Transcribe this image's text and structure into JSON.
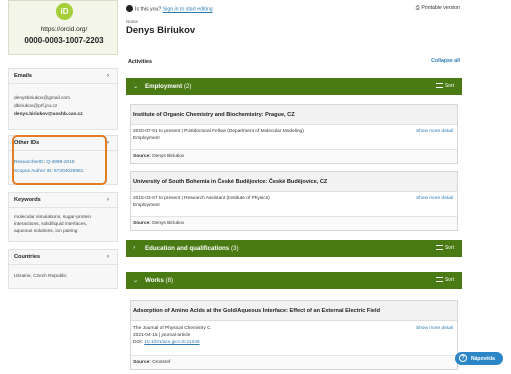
{
  "orcid": {
    "logo": "iD",
    "url": "https://orcid.org/",
    "number": "0000-0003-1007-2203"
  },
  "sidebar": {
    "emails": {
      "title": "Emails",
      "items": [
        "denysbiriukov@gmail.com",
        "dbiriukov@prf.jcu.cz",
        "denys.biriukov@uochb.cas.cz"
      ]
    },
    "other_ids": {
      "title": "Other IDs",
      "items": [
        "ResearcherID: Q-4898-2018",
        "Scopus Author ID: 57204029881"
      ]
    },
    "keywords": {
      "title": "Keywords",
      "lines": [
        "molecular simulations, sugar-protein",
        "interactions, solid/liquid interfaces,",
        "aqueous solutions, ion pairing"
      ]
    },
    "countries": {
      "title": "Countries",
      "text": "Ukraine, Czech Republic"
    }
  },
  "header": {
    "prompt": "Is this you?",
    "signin_link": "Sign in to start editing",
    "printable": "Printable version",
    "name_label": "Name",
    "person_name": "Denys Biriukov"
  },
  "activities": {
    "title": "Activities",
    "collapse_all": "Collapse all",
    "sort_label": "Sort",
    "employment": {
      "title": "Employment",
      "count": "(2)",
      "items": [
        {
          "org": "Institute of Organic Chemistry and Biochemistry: Prague, CZ",
          "line1": "2020-07-01 to present | Postdoctoral Fellow (Department of Molecular Modeling)",
          "line2": "Employment",
          "show_more": "Show more detail",
          "source_label": "Source:",
          "source": "Denys Biriukov"
        },
        {
          "org": "University of South Bohemia in České Budějovice: České Budějovice, CZ",
          "line1": "2016-03-07 to present | Research Assistant (Institute of Physics)",
          "line2": "Employment",
          "show_more": "Show more detail",
          "source_label": "Source:",
          "source": "Denys Biriukov"
        }
      ]
    },
    "education": {
      "title": "Education and qualifications",
      "count": "(3)"
    },
    "works": {
      "title": "Works",
      "count": "(8)",
      "items": [
        {
          "title": "Adsorption of Amino Acids at the Gold/Aqueous Interface: Effect of an External Electric Field",
          "journal": "The Journal of Physical Chemistry C",
          "meta": "2021-04-15 | journal-article",
          "doi_label": "DOI:",
          "doi": "10.1021/acs.jpcc.0c11248",
          "show_more": "Show more detail",
          "source_label": "Source:",
          "source": "Crossref"
        }
      ]
    }
  },
  "help": {
    "label": "Nápověda"
  },
  "colors": {
    "orcid_green": "#a6ce39",
    "section_bar": "#4a7a14",
    "link": "#2e7bb3",
    "highlight": "#e27c27",
    "help_button": "#2d87c7"
  }
}
